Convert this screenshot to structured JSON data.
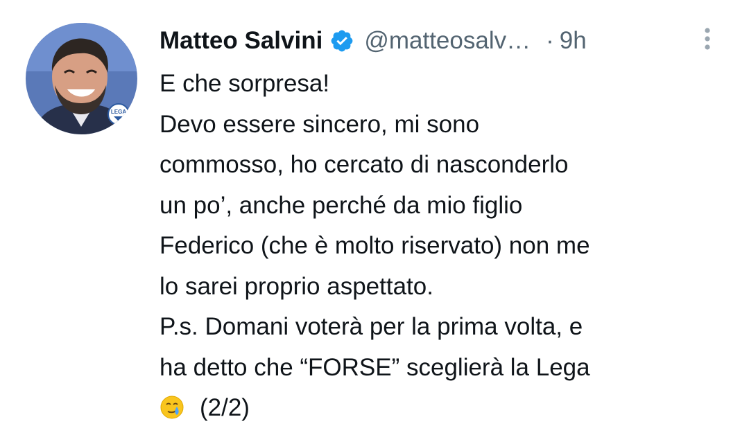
{
  "author": {
    "display_name": "Matteo Salvini",
    "handle": "@matteosalv…",
    "separator": "·",
    "timestamp": "9h",
    "verified": true,
    "avatar_badge_text": "LEGA"
  },
  "icons": {
    "verified": "verified-badge-icon",
    "more": "more-options-icon",
    "emoji": "face-holding-back-tears-emoji"
  },
  "tweet": {
    "lines": [
      "E che sorpresa!",
      "Devo essere sincero, mi sono",
      "commosso, ho cercato di nasconderlo",
      "un po’, anche perché da mio figlio",
      "Federico (che è molto riservato) non me",
      "lo sarei proprio aspettato.",
      "P.s. Domani voterà per la prima volta, e",
      "ha detto che “FORSE” sceglierà la Lega"
    ],
    "last_line_suffix": "(2/2)"
  },
  "colors": {
    "text": "#0f1419",
    "secondary": "#536471",
    "verified_blue": "#1d9bf0"
  }
}
